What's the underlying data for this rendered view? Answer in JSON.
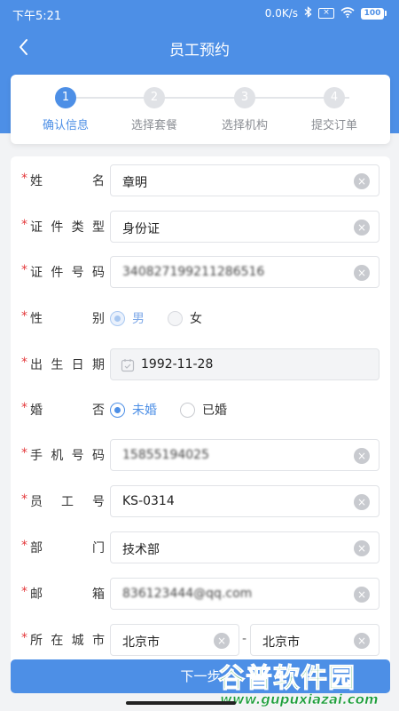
{
  "status_bar": {
    "time": "下午5:21",
    "network_speed": "0.0K/s",
    "icons": [
      "bluetooth-icon",
      "sim-icon",
      "wifi-icon"
    ],
    "battery": "100"
  },
  "nav": {
    "title": "员工预约",
    "back_icon": "chevron-left-icon"
  },
  "steps": [
    {
      "number": "1",
      "label": "确认信息",
      "active": true
    },
    {
      "number": "2",
      "label": "选择套餐",
      "active": false
    },
    {
      "number": "3",
      "label": "选择机构",
      "active": false
    },
    {
      "number": "4",
      "label": "提交订单",
      "active": false
    }
  ],
  "form": {
    "required_mark": "*",
    "name": {
      "label": "姓名",
      "value": "章明"
    },
    "id_type": {
      "label": "证件类型",
      "value": "身份证"
    },
    "id_number": {
      "label": "证件号码",
      "value": "340827199211286516"
    },
    "gender": {
      "label": "性别",
      "options": [
        "男",
        "女"
      ],
      "selected": "男"
    },
    "birth_date": {
      "label": "出生日期",
      "value": "1992-11-28"
    },
    "marital": {
      "label": "婚否",
      "options": [
        "未婚",
        "已婚"
      ],
      "selected": "未婚"
    },
    "phone": {
      "label": "手机号码",
      "value": "15855194025"
    },
    "employee_no": {
      "label": "员工号",
      "value": "KS-0314"
    },
    "department": {
      "label": "部门",
      "value": "技术部"
    },
    "email": {
      "label": "邮箱",
      "value": "836123444@qq.com"
    },
    "city": {
      "label": "所在城市",
      "province": "北京市",
      "city": "北京市",
      "separator": "-"
    }
  },
  "next_button": {
    "label": "下一步"
  },
  "watermark": {
    "title": "谷普软件园",
    "url": "www.gupuxiazai.com"
  },
  "colors": {
    "primary": "#4d8fe6",
    "required": "#e4393c",
    "watermark": "#1e9e3c"
  }
}
